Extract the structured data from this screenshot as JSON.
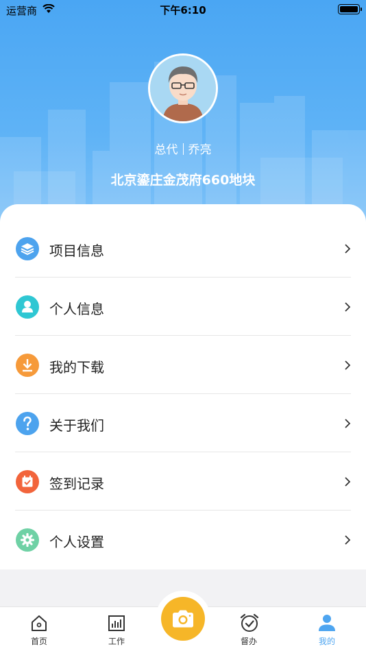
{
  "status": {
    "carrier": "运营商",
    "time": "下午6:10"
  },
  "profile": {
    "role": "总代",
    "name": "乔亮",
    "project": "北京鎏庄金茂府660地块"
  },
  "menu": [
    {
      "label": "项目信息",
      "icon": "layers-icon",
      "color": "#4da3ee"
    },
    {
      "label": "个人信息",
      "icon": "person-icon",
      "color": "#2fc7d3"
    },
    {
      "label": "我的下载",
      "icon": "download-icon",
      "color": "#f69a3a"
    },
    {
      "label": "关于我们",
      "icon": "question-icon",
      "color": "#4da3ee"
    },
    {
      "label": "签到记录",
      "icon": "calendar-check-icon",
      "color": "#f2643b"
    },
    {
      "label": "个人设置",
      "icon": "gear-icon",
      "color": "#6fd1a5"
    }
  ],
  "tabs": [
    {
      "label": "首页",
      "icon": "home-icon"
    },
    {
      "label": "工作",
      "icon": "chart-icon"
    },
    {
      "label": "",
      "icon": "camera-icon"
    },
    {
      "label": "督办",
      "icon": "alarm-check-icon"
    },
    {
      "label": "我的",
      "icon": "user-icon",
      "active": true
    }
  ],
  "colors": {
    "header": "#4aa6f3",
    "accent": "#4ea5f0",
    "camera": "#f6b628"
  }
}
